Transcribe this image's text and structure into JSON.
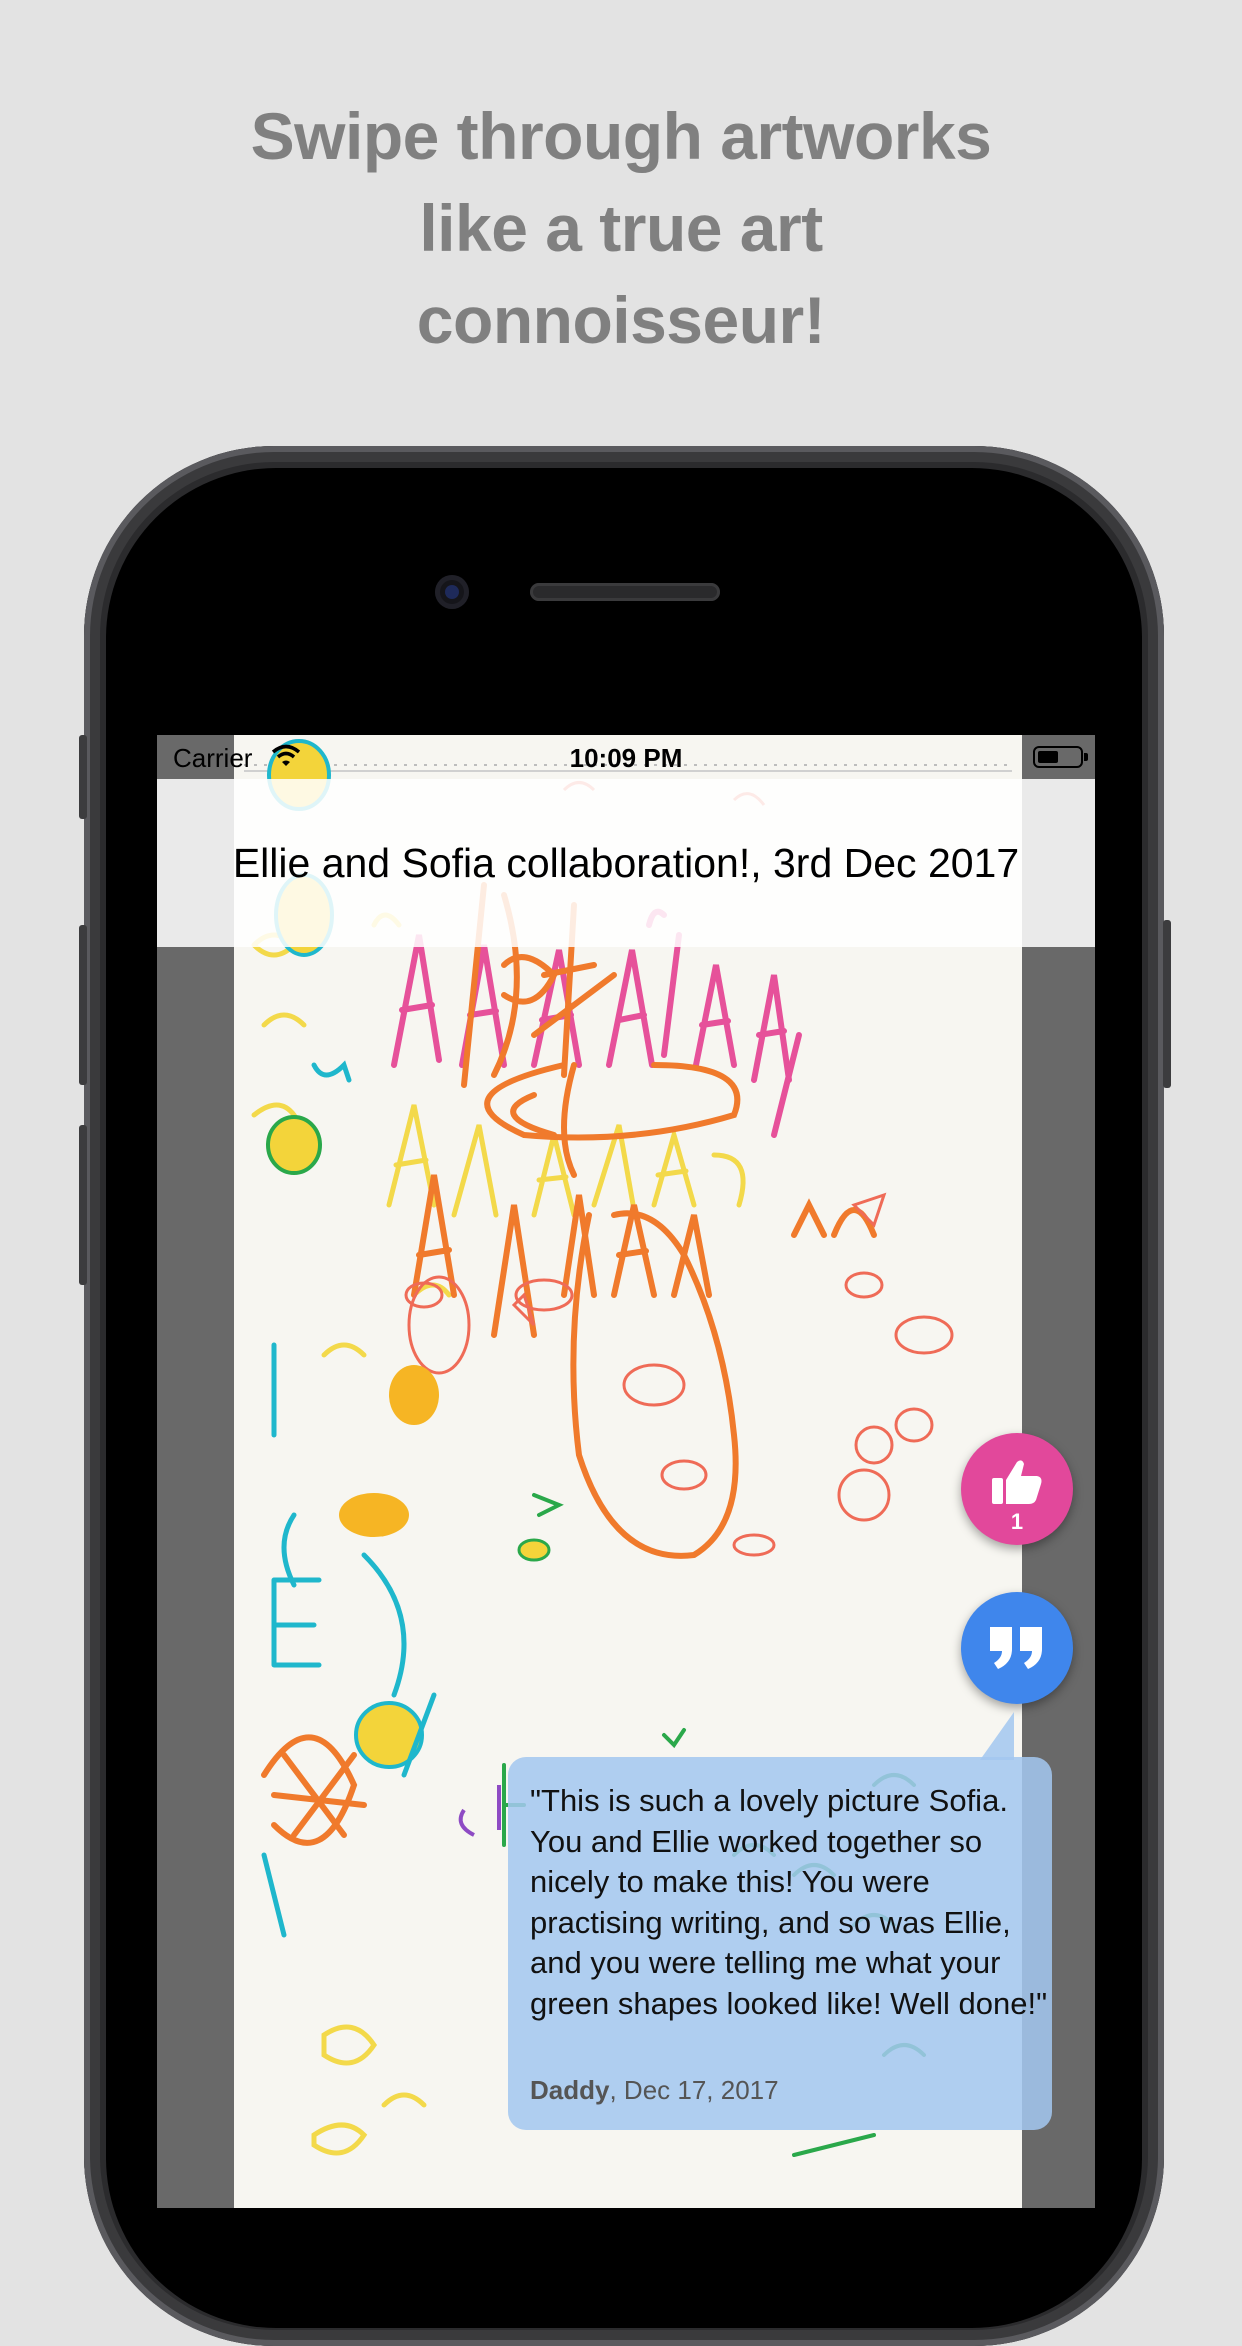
{
  "headline": {
    "lines": [
      "Swipe through artworks",
      "like a true art",
      "connoisseur!"
    ]
  },
  "status_bar": {
    "carrier": "Carrier",
    "time": "10:09 PM"
  },
  "artwork": {
    "title": "Ellie and Sofia collaboration!, 3rd Dec 2017"
  },
  "actions": {
    "like_icon": "thumbs-up-icon",
    "like_count": "1",
    "comment_icon": "quote-icon"
  },
  "comment": {
    "text": "\"This is such a lovely picture Sofia. You and Ellie worked together so nicely to make this! You were practising writing, and so was Ellie, and you were telling me what your green shapes looked like! Well done!\"",
    "author": "Daddy",
    "date": ", Dec 17, 2017"
  },
  "colors": {
    "background": "#e3e3e3",
    "headline": "#808080",
    "like_button": "#e2489b",
    "comment_button": "#3f86ec",
    "comment_bubble": "#a3c7f0"
  }
}
